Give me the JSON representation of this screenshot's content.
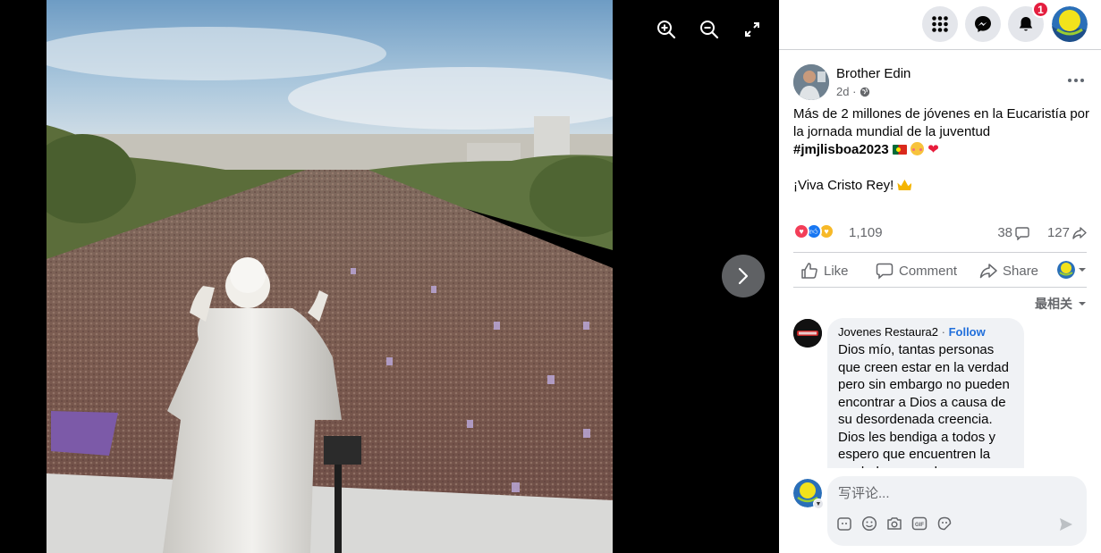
{
  "viewer": {
    "tools": [
      "zoom-in-icon",
      "zoom-out-icon",
      "fullscreen-icon"
    ],
    "next_icon": "chevron-right-icon"
  },
  "topbar": {
    "notifications_count": "1",
    "icons": [
      "menu-grid-icon",
      "messenger-icon",
      "bell-icon"
    ]
  },
  "post": {
    "author": "Brother Edin",
    "time": "2d ·",
    "text_line1": "Más de 2 millones de jóvenes en la Eucaristía por la jornada mundial de la juventud",
    "hashtag": "#jmjlisboa2023",
    "text_line2": "¡Viva Cristo Rey!",
    "reaction_count": "1,109",
    "comment_count": "38",
    "share_count": "127"
  },
  "actions": {
    "like": "Like",
    "comment": "Comment",
    "share": "Share"
  },
  "sort_label": "最相关",
  "comment": {
    "author": "Jovenes Restaura2",
    "separator": " · ",
    "follow": "Follow",
    "text": "Dios mío, tantas personas que creen estar en la verdad pero sin embargo no pueden encontrar a Dios a causa de su desordenada creencia. Dios les bendiga a todos y espero que encuentren la verdad que nos hace dichosos."
  },
  "composer": {
    "placeholder": "写评论..."
  },
  "colors": {
    "accent_blue": "#216fdb",
    "badge_red": "#e41e3f",
    "text_secondary": "#65676b"
  }
}
